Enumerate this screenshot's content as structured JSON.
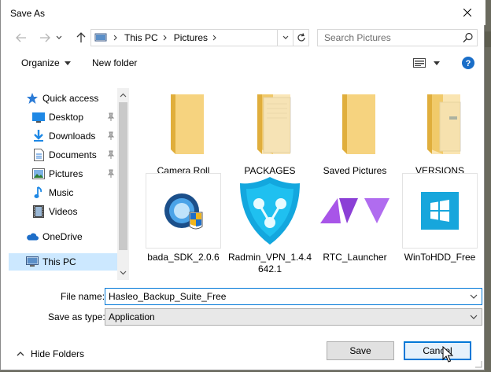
{
  "window": {
    "title": "Save As"
  },
  "nav": {
    "breadcrumb": [
      "This PC",
      "Pictures"
    ],
    "search_placeholder": "Search Pictures"
  },
  "toolbar": {
    "organize": "Organize",
    "new_folder": "New folder"
  },
  "sidebar": {
    "items": [
      {
        "label": "Quick access",
        "icon": "star-icon"
      },
      {
        "label": "Desktop",
        "icon": "desktop-icon",
        "pinned": true
      },
      {
        "label": "Downloads",
        "icon": "download-icon",
        "pinned": true
      },
      {
        "label": "Documents",
        "icon": "documents-icon",
        "pinned": true
      },
      {
        "label": "Pictures",
        "icon": "pictures-icon",
        "pinned": true
      },
      {
        "label": "Music",
        "icon": "music-icon"
      },
      {
        "label": "Videos",
        "icon": "videos-icon"
      },
      {
        "label": "OneDrive",
        "icon": "cloud-icon"
      },
      {
        "label": "This PC",
        "icon": "computer-icon",
        "selected": true
      }
    ]
  },
  "files": [
    {
      "name": "Camera Roll",
      "kind": "folder-icon"
    },
    {
      "name": "PACKAGES",
      "kind": "folder-with-document-icon"
    },
    {
      "name": "Saved Pictures",
      "kind": "folder-icon"
    },
    {
      "name": "VERSIONS",
      "kind": "folder-with-documents-icon"
    },
    {
      "name": "bada_SDK_2.0.6",
      "kind": "installer-icon"
    },
    {
      "name": "Radmin_VPN_1.4.4642.1",
      "kind": "radmin-vpn-icon"
    },
    {
      "name": "RTC_Launcher",
      "kind": "rtc-launcher-icon"
    },
    {
      "name": "WinToHDD_Free",
      "kind": "wintohdd-icon"
    }
  ],
  "form": {
    "file_name_label": "File name:",
    "file_name_value": "Hasleo_Backup_Suite_Free",
    "save_type_label": "Save as type:",
    "save_type_value": "Application"
  },
  "footer": {
    "hide_folders": "Hide Folders",
    "save": "Save",
    "cancel": "Cancel"
  },
  "colors": {
    "accent": "#0078d7",
    "folder": "#f4d27a",
    "selection": "#cce8ff"
  }
}
